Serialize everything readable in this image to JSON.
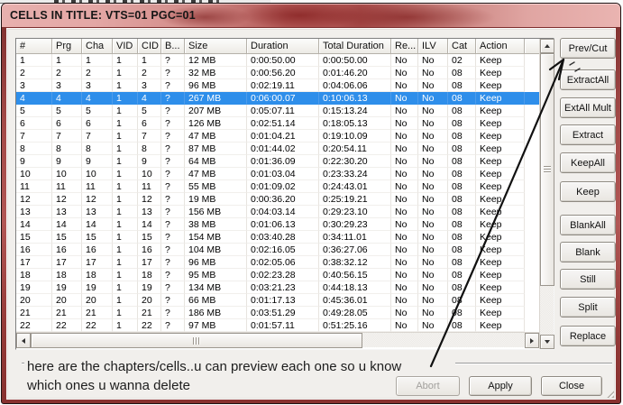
{
  "window": {
    "title": "CELLS IN TITLE: VTS=01 PGC=01"
  },
  "table": {
    "columns": [
      "#",
      "Prg",
      "Cha",
      "VID",
      "CID",
      "B...",
      "Size",
      "Duration",
      "Total Duration",
      "Re...",
      "ILV",
      "Cat",
      "Action"
    ],
    "selected_row": 4,
    "rows": [
      [
        "1",
        "1",
        "1",
        "1",
        "1",
        "?",
        "12 MB",
        "0:00:50.00",
        "0:00:50.00",
        "No",
        "No",
        "02",
        "Keep"
      ],
      [
        "2",
        "2",
        "2",
        "1",
        "2",
        "?",
        "32 MB",
        "0:00:56.20",
        "0:01:46.20",
        "No",
        "No",
        "08",
        "Keep"
      ],
      [
        "3",
        "3",
        "3",
        "1",
        "3",
        "?",
        "96 MB",
        "0:02:19.11",
        "0:04:06.06",
        "No",
        "No",
        "08",
        "Keep"
      ],
      [
        "4",
        "4",
        "4",
        "1",
        "4",
        "?",
        "267 MB",
        "0:06:00.07",
        "0:10:06.13",
        "No",
        "No",
        "08",
        "Keep"
      ],
      [
        "5",
        "5",
        "5",
        "1",
        "5",
        "?",
        "207 MB",
        "0:05:07.11",
        "0:15:13.24",
        "No",
        "No",
        "08",
        "Keep"
      ],
      [
        "6",
        "6",
        "6",
        "1",
        "6",
        "?",
        "126 MB",
        "0:02:51.14",
        "0:18:05.13",
        "No",
        "No",
        "08",
        "Keep"
      ],
      [
        "7",
        "7",
        "7",
        "1",
        "7",
        "?",
        "47 MB",
        "0:01:04.21",
        "0:19:10.09",
        "No",
        "No",
        "08",
        "Keep"
      ],
      [
        "8",
        "8",
        "8",
        "1",
        "8",
        "?",
        "87 MB",
        "0:01:44.02",
        "0:20:54.11",
        "No",
        "No",
        "08",
        "Keep"
      ],
      [
        "9",
        "9",
        "9",
        "1",
        "9",
        "?",
        "64 MB",
        "0:01:36.09",
        "0:22:30.20",
        "No",
        "No",
        "08",
        "Keep"
      ],
      [
        "10",
        "10",
        "10",
        "1",
        "10",
        "?",
        "47 MB",
        "0:01:03.04",
        "0:23:33.24",
        "No",
        "No",
        "08",
        "Keep"
      ],
      [
        "11",
        "11",
        "11",
        "1",
        "11",
        "?",
        "55 MB",
        "0:01:09.02",
        "0:24:43.01",
        "No",
        "No",
        "08",
        "Keep"
      ],
      [
        "12",
        "12",
        "12",
        "1",
        "12",
        "?",
        "19 MB",
        "0:00:36.20",
        "0:25:19.21",
        "No",
        "No",
        "08",
        "Keep"
      ],
      [
        "13",
        "13",
        "13",
        "1",
        "13",
        "?",
        "156 MB",
        "0:04:03.14",
        "0:29:23.10",
        "No",
        "No",
        "08",
        "Keep"
      ],
      [
        "14",
        "14",
        "14",
        "1",
        "14",
        "?",
        "38 MB",
        "0:01:06.13",
        "0:30:29.23",
        "No",
        "No",
        "08",
        "Keep"
      ],
      [
        "15",
        "15",
        "15",
        "1",
        "15",
        "?",
        "154 MB",
        "0:03:40.28",
        "0:34:11.01",
        "No",
        "No",
        "08",
        "Keep"
      ],
      [
        "16",
        "16",
        "16",
        "1",
        "16",
        "?",
        "104 MB",
        "0:02:16.05",
        "0:36:27.06",
        "No",
        "No",
        "08",
        "Keep"
      ],
      [
        "17",
        "17",
        "17",
        "1",
        "17",
        "?",
        "96 MB",
        "0:02:05.06",
        "0:38:32.12",
        "No",
        "No",
        "08",
        "Keep"
      ],
      [
        "18",
        "18",
        "18",
        "1",
        "18",
        "?",
        "95 MB",
        "0:02:23.28",
        "0:40:56.15",
        "No",
        "No",
        "08",
        "Keep"
      ],
      [
        "19",
        "19",
        "19",
        "1",
        "19",
        "?",
        "134 MB",
        "0:03:21.23",
        "0:44:18.13",
        "No",
        "No",
        "08",
        "Keep"
      ],
      [
        "20",
        "20",
        "20",
        "1",
        "20",
        "?",
        "66 MB",
        "0:01:17.13",
        "0:45:36.01",
        "No",
        "No",
        "08",
        "Keep"
      ],
      [
        "21",
        "21",
        "21",
        "1",
        "21",
        "?",
        "186 MB",
        "0:03:51.29",
        "0:49:28.05",
        "No",
        "No",
        "08",
        "Keep"
      ],
      [
        "22",
        "22",
        "22",
        "1",
        "22",
        "?",
        "97 MB",
        "0:01:57.11",
        "0:51:25.16",
        "No",
        "No",
        "08",
        "Keep"
      ]
    ]
  },
  "side_buttons": [
    "Prev/Cut",
    "ExtractAll",
    "ExtAll Mult",
    "Extract",
    "KeepAll",
    "Keep",
    "BlankAll",
    "Blank",
    "Still",
    "Split",
    "Replace"
  ],
  "bottom_buttons": {
    "abort": "Abort",
    "apply": "Apply",
    "close": "Close"
  },
  "annotation": {
    "line1": "here are the chapters/cells..u can preview each one so u know",
    "line2": "which ones u wanna delete"
  },
  "icons": {
    "scroll_up": "triangle-up",
    "scroll_down": "triangle-down",
    "scroll_left": "triangle-left",
    "scroll_right": "triangle-right",
    "annotation_arrow": "hand-drawn-arrow",
    "resize_grip": "diagonal-grip"
  },
  "colors": {
    "selection": "#2E8EEA",
    "titlebar_pink": "#E2A6A4",
    "frame_red": "#9A3D3B",
    "client_gray": "#F1EFEC"
  }
}
